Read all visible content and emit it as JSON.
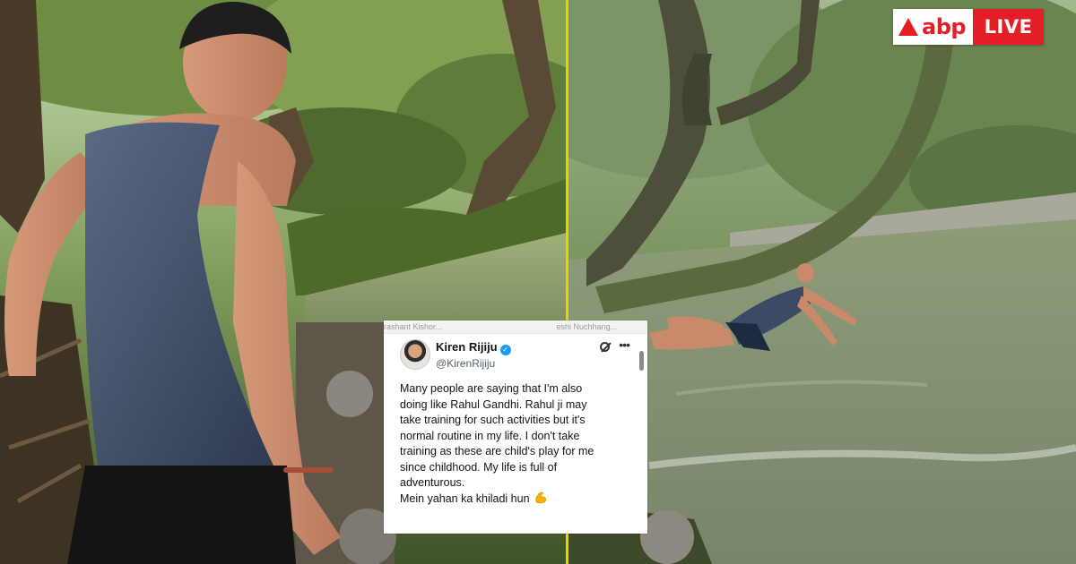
{
  "branding": {
    "name": "abp",
    "tag": "LIVE",
    "primary_color": "#e41e26"
  },
  "strip": {
    "left": "rashant Kishor...",
    "right": "eshi Nuchhang..."
  },
  "tweet": {
    "display_name": "Kiren Rijiju",
    "handle": "@KirenRijiju",
    "verified": true,
    "more_icon": "•••",
    "lines": [
      "Many people are saying that I'm also",
      "doing like Rahul Gandhi. Rahul ji may",
      "take training for such activities but it's",
      "normal routine in my life. I don't take",
      "training as these are child's play for me",
      "since childhood. My life is full of",
      "adventurous.",
      "Mein yahan ka khiladi hun"
    ],
    "emoji": "flexed-biceps"
  },
  "colors": {
    "divider": "#e8d300",
    "verified": "#1d9bf0"
  }
}
